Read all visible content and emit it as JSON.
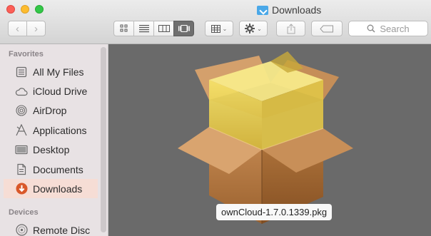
{
  "window": {
    "title": "Downloads"
  },
  "toolbar": {
    "back_icon": "chevron-left-icon",
    "forward_icon": "chevron-right-icon",
    "view_modes": [
      "icon-view",
      "list-view",
      "column-view",
      "cover-flow-view"
    ],
    "active_view": "cover-flow-view",
    "arrange_icon": "grid-icon",
    "action_icon": "gear-icon",
    "share_icon": "share-icon",
    "tags_icon": "tag-icon",
    "search_placeholder": "Search"
  },
  "sidebar": {
    "favorites_header": "Favorites",
    "items": [
      {
        "label": "All My Files",
        "icon": "all-files-icon"
      },
      {
        "label": "iCloud Drive",
        "icon": "cloud-icon"
      },
      {
        "label": "AirDrop",
        "icon": "airdrop-icon"
      },
      {
        "label": "Applications",
        "icon": "applications-icon"
      },
      {
        "label": "Desktop",
        "icon": "desktop-icon"
      },
      {
        "label": "Documents",
        "icon": "documents-icon"
      },
      {
        "label": "Downloads",
        "icon": "downloads-icon",
        "selected": true
      }
    ],
    "devices_header": "Devices",
    "devices": [
      {
        "label": "Remote Disc",
        "icon": "remote-disc-icon"
      }
    ]
  },
  "content": {
    "file_name": "ownCloud-1.7.0.1339.pkg",
    "file_icon": "package-box-icon"
  },
  "colors": {
    "sidebar_bg": "#e8e2e4",
    "selection": "#f6ddd5",
    "content_bg": "#6a6a6a",
    "download_accent": "#d9582a"
  }
}
